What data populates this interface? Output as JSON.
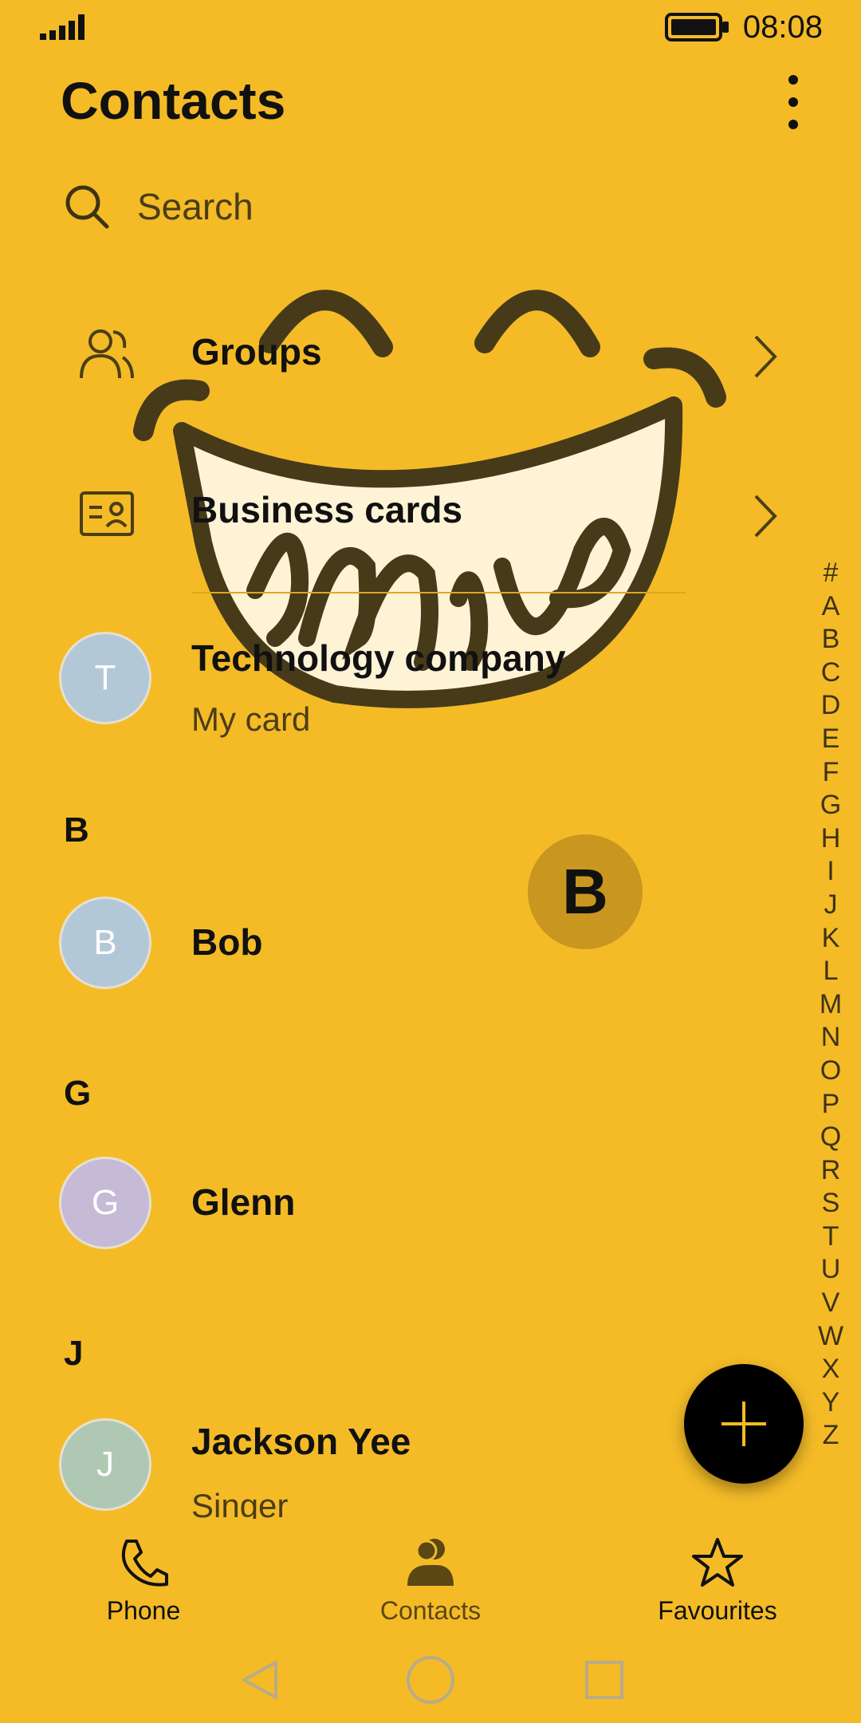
{
  "status": {
    "time": "08:08"
  },
  "header": {
    "title": "Contacts"
  },
  "search": {
    "placeholder": "Search"
  },
  "menu": {
    "groups": "Groups",
    "business_cards": "Business cards"
  },
  "my_card": {
    "initial": "T",
    "name": "Technology company",
    "subtitle": "My card"
  },
  "sections": [
    {
      "letter": "B",
      "contacts": [
        {
          "initial": "B",
          "name": "Bob",
          "subtitle": ""
        }
      ]
    },
    {
      "letter": "G",
      "contacts": [
        {
          "initial": "G",
          "name": "Glenn",
          "subtitle": ""
        }
      ]
    },
    {
      "letter": "J",
      "contacts": [
        {
          "initial": "J",
          "name": "Jackson Yee",
          "subtitle": "Singer"
        }
      ]
    }
  ],
  "index_letters": [
    "#",
    "A",
    "B",
    "C",
    "D",
    "E",
    "F",
    "G",
    "H",
    "I",
    "J",
    "K",
    "L",
    "M",
    "N",
    "O",
    "P",
    "Q",
    "R",
    "S",
    "T",
    "U",
    "V",
    "W",
    "X",
    "Y",
    "Z"
  ],
  "index_popup": "B",
  "bottom_nav": {
    "phone": "Phone",
    "contacts": "Contacts",
    "favourites": "Favourites"
  },
  "colors": {
    "background": "#F4BB27",
    "accent": "#C9961F",
    "fab": "#000000"
  }
}
